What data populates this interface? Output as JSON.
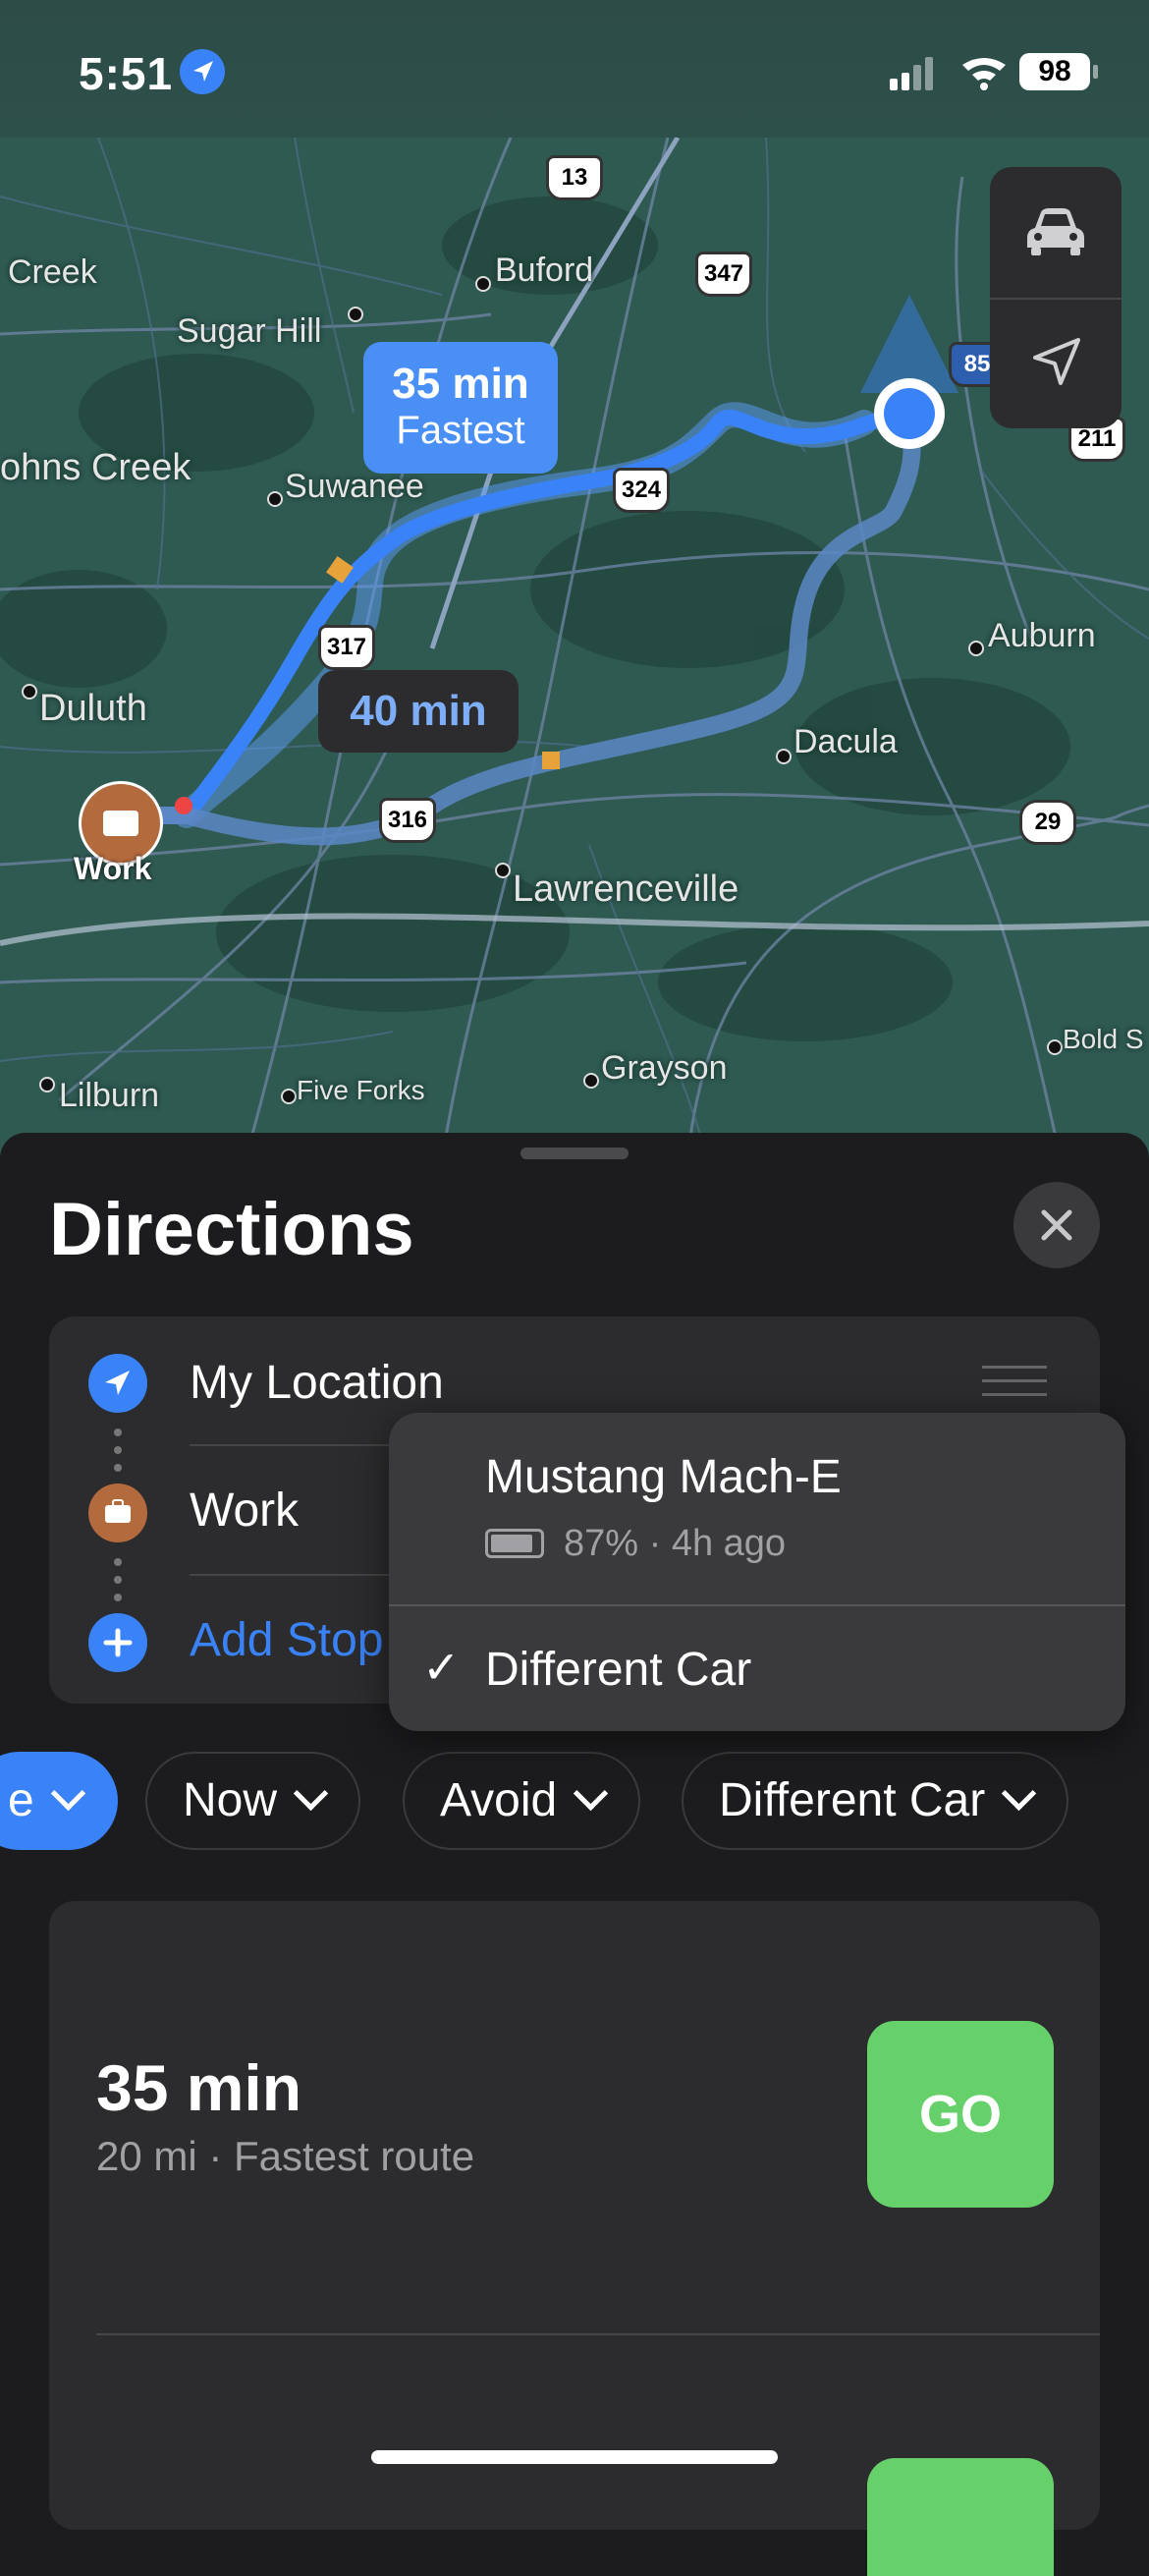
{
  "status_bar": {
    "time": "5:51",
    "battery": "98"
  },
  "map": {
    "places": [
      "Creek",
      "Buford",
      "Sugar Hill",
      "ohns Creek",
      "Suwanee",
      "Auburn",
      "Duluth",
      "Dacula",
      "Lawrenceville",
      "Grayson",
      "Lilburn",
      "Five Forks",
      "Bold S"
    ],
    "shields": [
      "13",
      "347",
      "324",
      "317",
      "316",
      "29",
      "85",
      "211"
    ],
    "fastest_callout": {
      "time": "35 min",
      "label": "Fastest"
    },
    "alt_callout": {
      "time": "40 min"
    },
    "work_label": "Work",
    "controls": [
      "car-icon",
      "location-arrow-icon"
    ]
  },
  "sheet": {
    "title": "Directions",
    "route": {
      "from": "My Location",
      "to": "Work",
      "add_stop": "Add Stop"
    },
    "vehicle_menu": {
      "car_name": "Mustang Mach-E",
      "car_status": "87% · 4h ago",
      "selected": "Different Car",
      "check": "✓"
    },
    "filters": {
      "mode": "e",
      "time": "Now",
      "avoid": "Avoid",
      "vehicle": "Different Car"
    },
    "result": {
      "time": "35 min",
      "details": "20 mi · Fastest route",
      "go_label": "GO"
    }
  },
  "colors": {
    "accent": "#3a82f7",
    "go": "#66d16b",
    "route": "#4a8ff5",
    "work": "#b36a3d"
  }
}
